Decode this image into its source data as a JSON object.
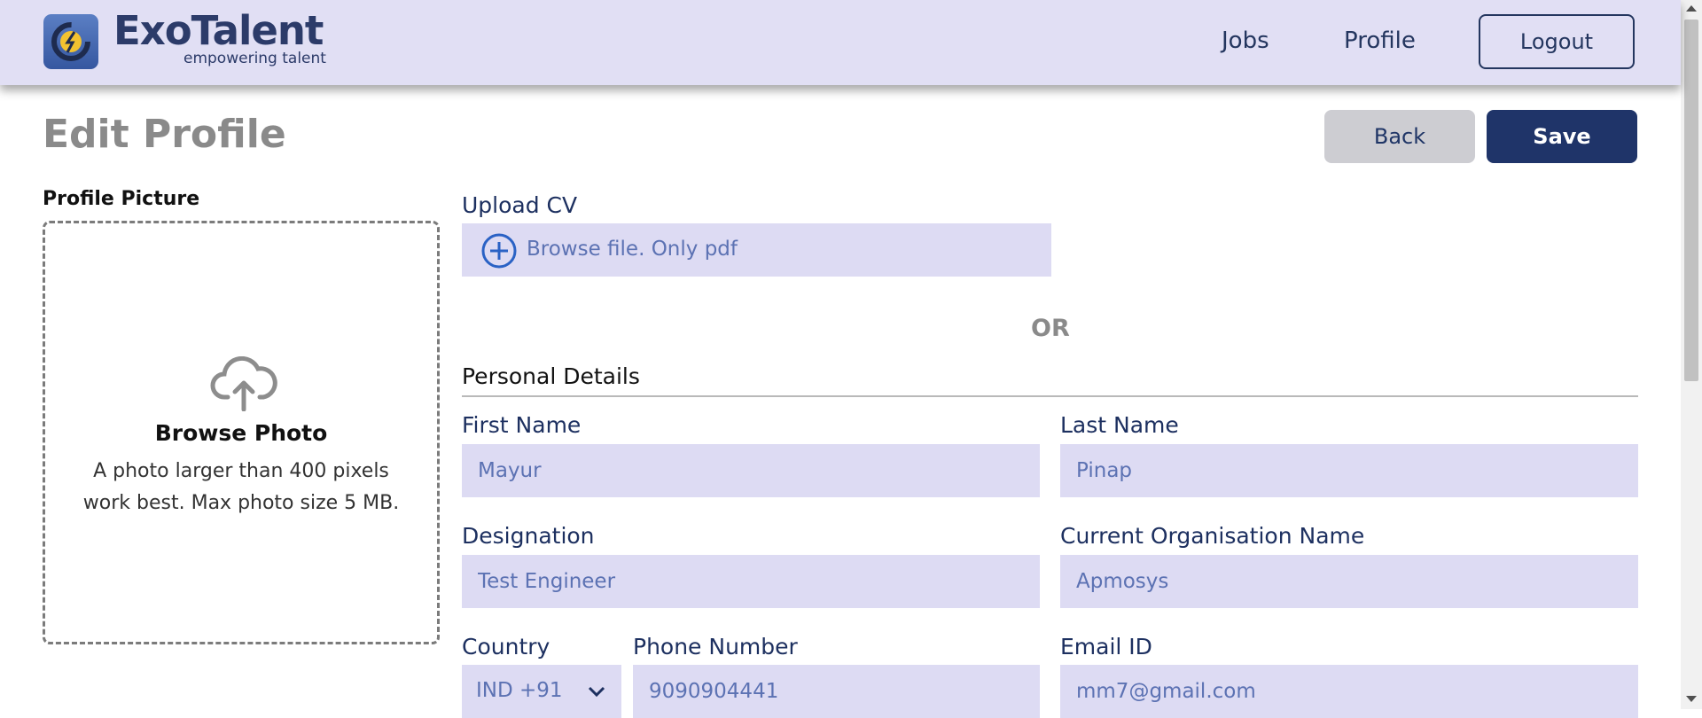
{
  "header": {
    "brand_name": "ExoTalent",
    "brand_tagline": "empowering talent",
    "nav": {
      "jobs": "Jobs",
      "profile": "Profile"
    },
    "logout_label": "Logout",
    "logo_icon": "exotalent-logo-icon"
  },
  "page": {
    "title": "Edit Profile",
    "back_label": "Back",
    "save_label": "Save"
  },
  "profile_picture": {
    "label": "Profile Picture",
    "browse_title": "Browse Photo",
    "browse_desc": "A photo larger than 400 pixels work best. Max photo size 5 MB.",
    "icon": "cloud-upload-icon"
  },
  "upload_cv": {
    "label": "Upload CV",
    "placeholder": "Browse file. Only pdf",
    "icon": "plus-circle-icon"
  },
  "or_text": "OR",
  "personal_details": {
    "title": "Personal Details",
    "first_name": {
      "label": "First Name",
      "value": "Mayur"
    },
    "last_name": {
      "label": "Last Name",
      "value": "Pinap"
    },
    "designation": {
      "label": "Designation",
      "value": "Test Engineer"
    },
    "organisation": {
      "label": "Current Organisation Name",
      "value": "Apmosys"
    },
    "country": {
      "label": "Country",
      "value": "IND +91"
    },
    "phone": {
      "label": "Phone Number",
      "value": "9090904441"
    },
    "email": {
      "label": "Email ID",
      "value": "mm7@gmail.com"
    }
  },
  "colors": {
    "header_bg": "#e1dff4",
    "input_bg": "#dddbf3",
    "primary": "#1f3469",
    "input_text": "#5c72b3"
  }
}
